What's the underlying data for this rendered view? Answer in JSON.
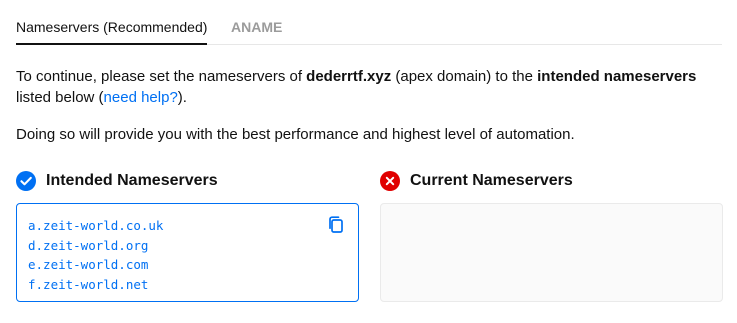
{
  "tabs": [
    {
      "label": "Nameservers (Recommended)",
      "active": true
    },
    {
      "label": "ANAME",
      "active": false
    }
  ],
  "intro": {
    "prefix": "To continue, please set the nameservers of ",
    "domain": "dederrtf.xyz",
    "middle": " (apex domain) to the ",
    "highlight": "intended nameservers",
    "line_break_text": " listed below (",
    "help_link": "need help?",
    "suffix": ")."
  },
  "benefit_text": "Doing so will provide you with the best performance and highest level of automation.",
  "intended": {
    "title": "Intended Nameservers",
    "status_icon": "check-circle-icon",
    "nameservers": [
      "a.zeit-world.co.uk",
      "d.zeit-world.org",
      "e.zeit-world.com",
      "f.zeit-world.net"
    ],
    "copy_icon": "copy-icon"
  },
  "current": {
    "title": "Current Nameservers",
    "status_icon": "x-circle-icon",
    "nameservers": []
  },
  "colors": {
    "accent": "#0070f3",
    "error": "#e00000",
    "text": "#111111",
    "muted_tab": "#9b9b9b",
    "border": "#eaeaea"
  }
}
